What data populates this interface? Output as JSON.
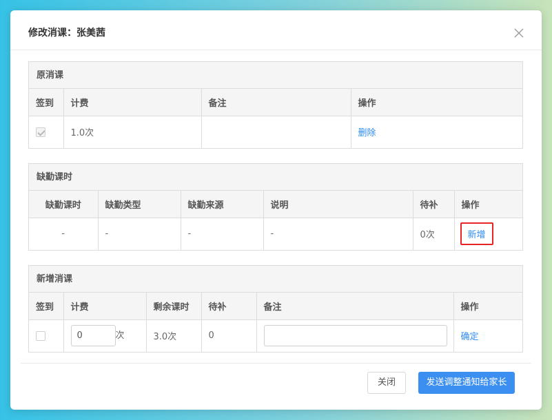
{
  "dialog": {
    "title": "修改消课：张美茜",
    "close_label": "关闭",
    "send_label": "发送调整通知给家长"
  },
  "original": {
    "title": "原消课",
    "headers": [
      "签到",
      "计费",
      "备注",
      "操作"
    ],
    "row": {
      "signed": true,
      "fee": "1.0次",
      "remark": "",
      "action": "删除"
    }
  },
  "absence": {
    "title": "缺勤课时",
    "headers": [
      "缺勤课时",
      "缺勤类型",
      "缺勤来源",
      "说明",
      "待补",
      "操作"
    ],
    "row": {
      "hours": "-",
      "type": "-",
      "source": "-",
      "note": "-",
      "pending": "0次",
      "action": "新增"
    }
  },
  "new_lesson": {
    "title": "新增消课",
    "headers": [
      "签到",
      "计费",
      "剩余课时",
      "待补",
      "备注",
      "操作"
    ],
    "row": {
      "signed": false,
      "fee_value": "0",
      "fee_unit": "次",
      "remaining": "3.0次",
      "pending": "0",
      "remark_value": "",
      "action": "确定"
    }
  }
}
